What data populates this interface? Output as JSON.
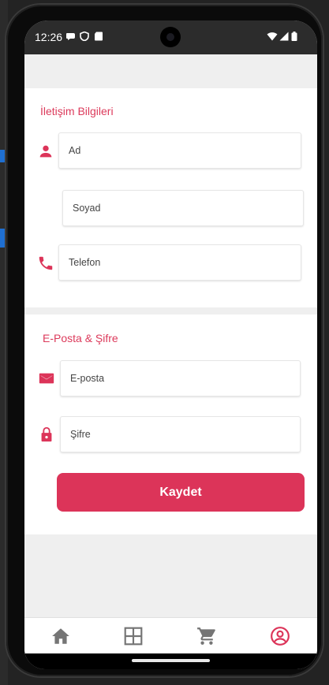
{
  "status_bar": {
    "time": "12:26"
  },
  "contact_section": {
    "title": "İletişim Bilgileri",
    "first_name_placeholder": "Ad",
    "last_name_placeholder": "Soyad",
    "phone_placeholder": "Telefon"
  },
  "credentials_section": {
    "title": "E-Posta & Şifre",
    "email_placeholder": "E-posta",
    "password_placeholder": "Şifre"
  },
  "save_button": {
    "label": "Kaydet"
  },
  "bottom_nav": {
    "items": [
      {
        "icon": "home-icon",
        "active": false
      },
      {
        "icon": "grid-icon",
        "active": false
      },
      {
        "icon": "cart-icon",
        "active": false
      },
      {
        "icon": "profile-icon",
        "active": true
      }
    ]
  },
  "colors": {
    "accent": "#dc3459",
    "nav_inactive": "#757575",
    "background": "#efefef"
  }
}
